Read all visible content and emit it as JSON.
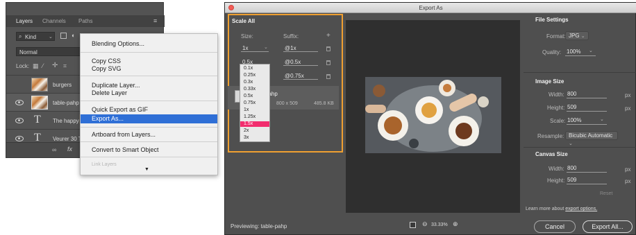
{
  "layers_panel": {
    "tabs": [
      "Layers",
      "Channels",
      "Paths"
    ],
    "filter_label": "Kind",
    "blend_mode": "Normal",
    "lock_label": "Lock:",
    "layers": [
      {
        "name": "burgers",
        "type": "image"
      },
      {
        "name": "table-pahp",
        "type": "image"
      },
      {
        "name": "The happy",
        "type": "text"
      },
      {
        "name": "Veurer 30 T",
        "type": "text"
      }
    ],
    "footer_fx": "fx"
  },
  "context_menu": {
    "items": [
      "Blending Options...",
      "Copy CSS",
      "Copy SVG",
      "Duplicate Layer...",
      "Delete Layer",
      "Quick Export as GIF",
      "Export As...",
      "Artboard from Layers...",
      "Convert to Smart Object",
      "Link Layers"
    ],
    "highlighted": "Export As...",
    "more_arrow": "▼"
  },
  "export_dialog": {
    "title": "Export As",
    "scale_all": {
      "header": "Scale All",
      "size_label": "Size:",
      "suffix_label": "Suffix:",
      "add_symbol": "+",
      "rows": [
        {
          "size": "1x",
          "suffix": "@1x"
        },
        {
          "size": "0.5x",
          "suffix": "@0.5x"
        },
        {
          "size": "",
          "suffix": "@0.75x"
        }
      ],
      "dropdown_options": [
        "0.1x",
        "0.25x",
        "0.3x",
        "0.33x",
        "0.5x",
        "0.75x",
        "1x",
        "1.25x",
        "1.5x",
        "2x",
        "3x"
      ],
      "dropdown_selected": "1.5x"
    },
    "file_row": {
      "name": "table-pahp",
      "dimensions": "800 x 509",
      "size": "485.8 KB"
    },
    "previewing": "Previewing: table-pahp",
    "zoom": "33.33%",
    "file_settings": {
      "header": "File Settings",
      "format_label": "Format:",
      "format_value": "JPG",
      "quality_label": "Quality:",
      "quality_value": "100%"
    },
    "image_size": {
      "header": "Image Size",
      "width_label": "Width:",
      "width_value": "800",
      "height_label": "Height:",
      "height_value": "509",
      "scale_label": "Scale:",
      "scale_value": "100%",
      "resample_label": "Resample:",
      "resample_value": "Bicubic Automatic",
      "unit": "px"
    },
    "canvas_size": {
      "header": "Canvas Size",
      "width_label": "Width:",
      "width_value": "800",
      "height_label": "Height:",
      "height_value": "509",
      "unit": "px",
      "reset_label": "Reset"
    },
    "learn_more_text": "Learn more about",
    "learn_more_link": "export options.",
    "cancel_label": "Cancel",
    "export_label": "Export All..."
  }
}
